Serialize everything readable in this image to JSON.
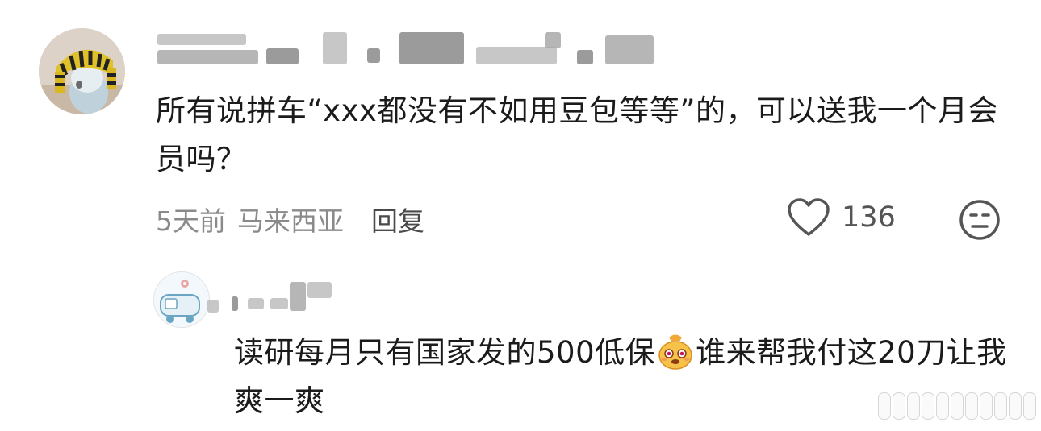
{
  "comment": {
    "text": "所有说拼车“xxx都没有不如用豆包等等”的，可以送我一个月会员吗？",
    "time": "5天前",
    "location": "马来西亚",
    "reply_label": "回复",
    "like_count": "136"
  },
  "reply": {
    "text_before_emoji": "读研每月只有国家发的500低保",
    "text_after_emoji": "谁来帮我付这20刀让我爽一爽"
  },
  "icons": {
    "like": "heart-outline-icon",
    "dislike": "meh-face-icon",
    "emoji": "smiling-sack-emoji"
  },
  "colors": {
    "text": "#1b1b1b",
    "meta": "#8a8a8a",
    "background": "#ffffff"
  }
}
